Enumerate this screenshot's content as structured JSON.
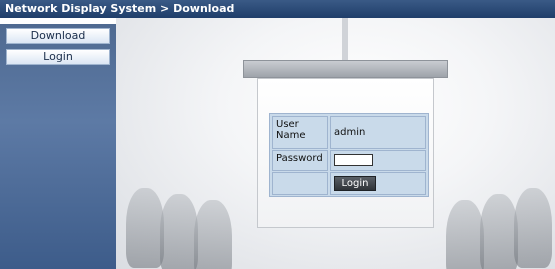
{
  "header": {
    "title": "Network Display System > Download"
  },
  "sidebar": {
    "items": [
      {
        "label": "Download"
      },
      {
        "label": "Login"
      }
    ]
  },
  "login": {
    "username_label": "User Name",
    "username_value": "admin",
    "password_label": "Password",
    "password_value": "",
    "submit_label": "Login"
  }
}
